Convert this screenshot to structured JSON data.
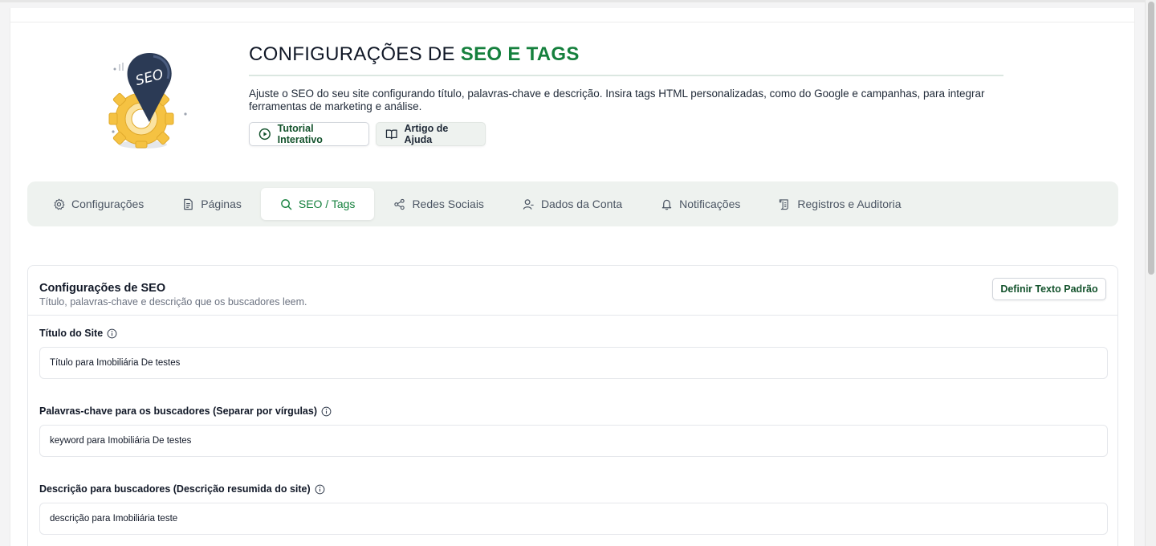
{
  "hero": {
    "title_prefix": "CONFIGURAÇÕES DE ",
    "title_accent": "SEO E TAGS",
    "description": "Ajuste o SEO do seu site configurando título, palavras-chave e descrição. Insira tags HTML personalizadas, como do Google e campanhas, para integrar ferramentas de marketing e análise.",
    "tutorial_button": "Tutorial Interativo",
    "help_button": "Artigo de Ajuda",
    "illustration_text": "SEO"
  },
  "tabs": [
    {
      "label": "Configurações",
      "icon": "gear-icon",
      "active": false
    },
    {
      "label": "Páginas",
      "icon": "document-icon",
      "active": false
    },
    {
      "label": "SEO / Tags",
      "icon": "search-icon",
      "active": true
    },
    {
      "label": "Redes Sociais",
      "icon": "share-icon",
      "active": false
    },
    {
      "label": "Dados da Conta",
      "icon": "user-icon",
      "active": false
    },
    {
      "label": "Notificações",
      "icon": "bell-icon",
      "active": false
    },
    {
      "label": "Registros e Auditoria",
      "icon": "scroll-icon",
      "active": false
    }
  ],
  "seo_card": {
    "title": "Configurações de SEO",
    "subtitle": "Título, palavras-chave e descrição que os buscadores leem.",
    "default_button": "Definir Texto Padrão",
    "fields": [
      {
        "label": "Título do Site",
        "value": "Título para Imobiliária De testes"
      },
      {
        "label": "Palavras-chave para os buscadores (Separar por vírgulas)",
        "value": "keyword para Imobiliária De testes"
      },
      {
        "label": "Descrição para buscadores (Descrição resumida do site)",
        "value": "descrição para Imobiliária teste"
      }
    ]
  },
  "colors": {
    "accent": "#15803d",
    "tab_bar_bg": "#eef2ef",
    "illustration_pin": "#2b3a55",
    "illustration_gear": "#f5c242"
  }
}
